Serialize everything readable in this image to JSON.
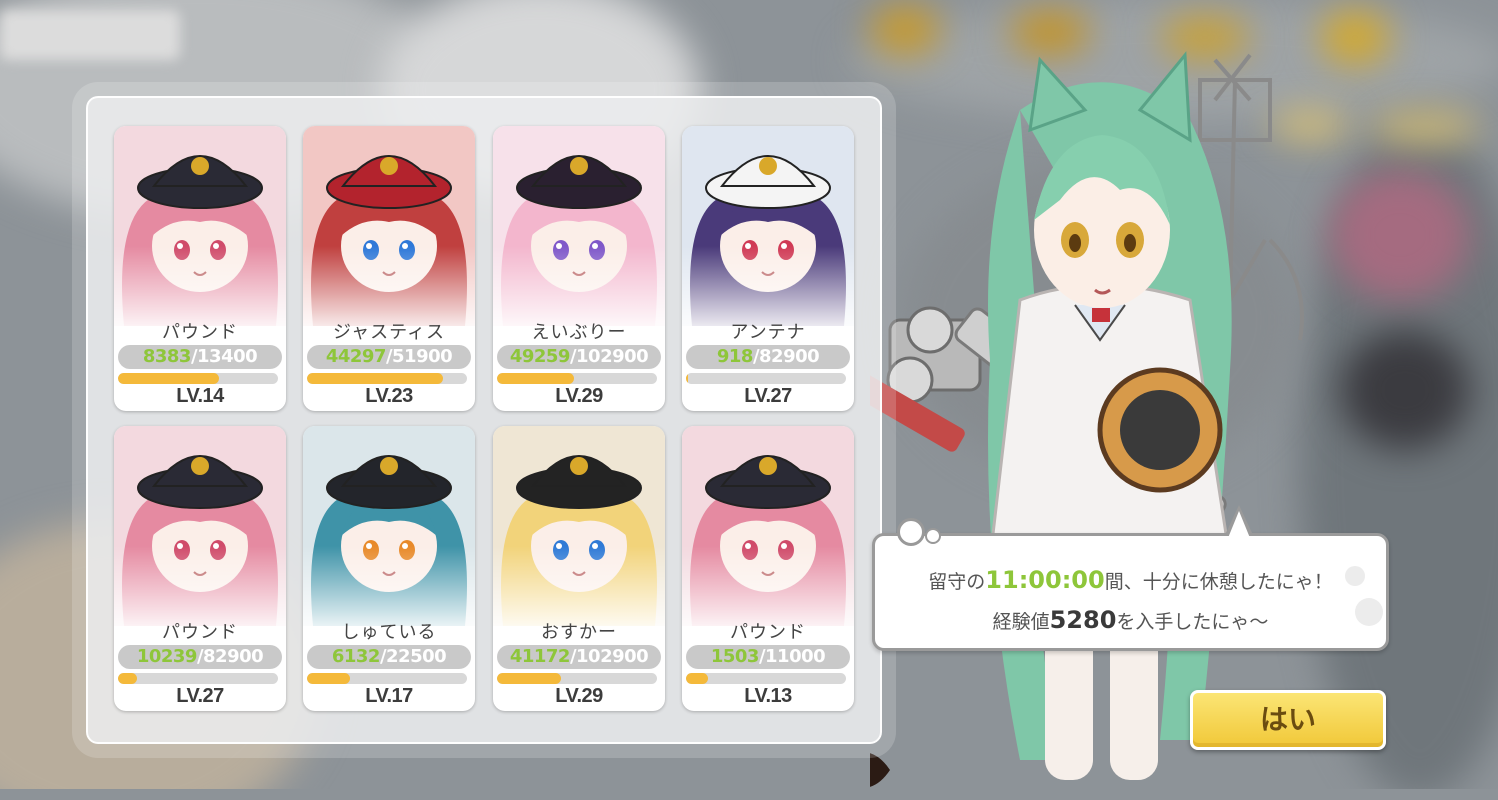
{
  "cards": [
    {
      "name": "パウンド",
      "exp_current": "8383",
      "exp_max": "13400",
      "level": "LV.14",
      "progress": 0.63,
      "colors": {
        "hair": "#e58aa1",
        "hat": "#2a2a35",
        "bg": "#f3d9df",
        "eye": "#d04b6a"
      }
    },
    {
      "name": "ジャスティス",
      "exp_current": "44297",
      "exp_max": "51900",
      "level": "LV.23",
      "progress": 0.85,
      "colors": {
        "hair": "#c0403f",
        "hat": "#b3232d",
        "bg": "#f2c7c4",
        "eye": "#2e78d8"
      }
    },
    {
      "name": "えいぶりー",
      "exp_current": "49259",
      "exp_max": "102900",
      "level": "LV.29",
      "progress": 0.48,
      "colors": {
        "hair": "#f3b6cd",
        "hat": "#2a2030",
        "bg": "#f7e1ea",
        "eye": "#7f58c9"
      }
    },
    {
      "name": "アンテナ",
      "exp_current": "918",
      "exp_max": "82900",
      "level": "LV.27",
      "progress": 0.01,
      "colors": {
        "hair": "#4a3a7a",
        "hat": "#f4f4f4",
        "bg": "#dfe6f0",
        "eye": "#d03a55"
      }
    },
    {
      "name": "パウンド",
      "exp_current": "10239",
      "exp_max": "82900",
      "level": "LV.27",
      "progress": 0.12,
      "colors": {
        "hair": "#e58aa1",
        "hat": "#2a2a35",
        "bg": "#f3d9df",
        "eye": "#d04b6a"
      }
    },
    {
      "name": "しゅている",
      "exp_current": "6132",
      "exp_max": "22500",
      "level": "LV.17",
      "progress": 0.27,
      "colors": {
        "hair": "#3f93a8",
        "hat": "#23252b",
        "bg": "#dbe6ea",
        "eye": "#e88a2a"
      }
    },
    {
      "name": "おすかー",
      "exp_current": "41172",
      "exp_max": "102900",
      "level": "LV.29",
      "progress": 0.4,
      "colors": {
        "hair": "#f2d37a",
        "hat": "#232323",
        "bg": "#efe6d4",
        "eye": "#2f7ad6"
      }
    },
    {
      "name": "パウンド",
      "exp_current": "1503",
      "exp_max": "11000",
      "level": "LV.13",
      "progress": 0.14,
      "colors": {
        "hair": "#e58aa1",
        "hat": "#2a2a35",
        "bg": "#f3d9df",
        "eye": "#d04b6a"
      }
    }
  ],
  "message": {
    "l1_a": "留守の",
    "l1_time": "11:00:00",
    "l1_b": "間、十分に休憩したにゃ！",
    "l2_a": "経験値",
    "l2_exp": "5280",
    "l2_b": "を入手したにゃ～"
  },
  "confirm_button": "はい",
  "colors": {
    "exp_green": "#8ec63a",
    "bar_fill": "#f4b93a",
    "button_yellow": "#f1c838"
  }
}
